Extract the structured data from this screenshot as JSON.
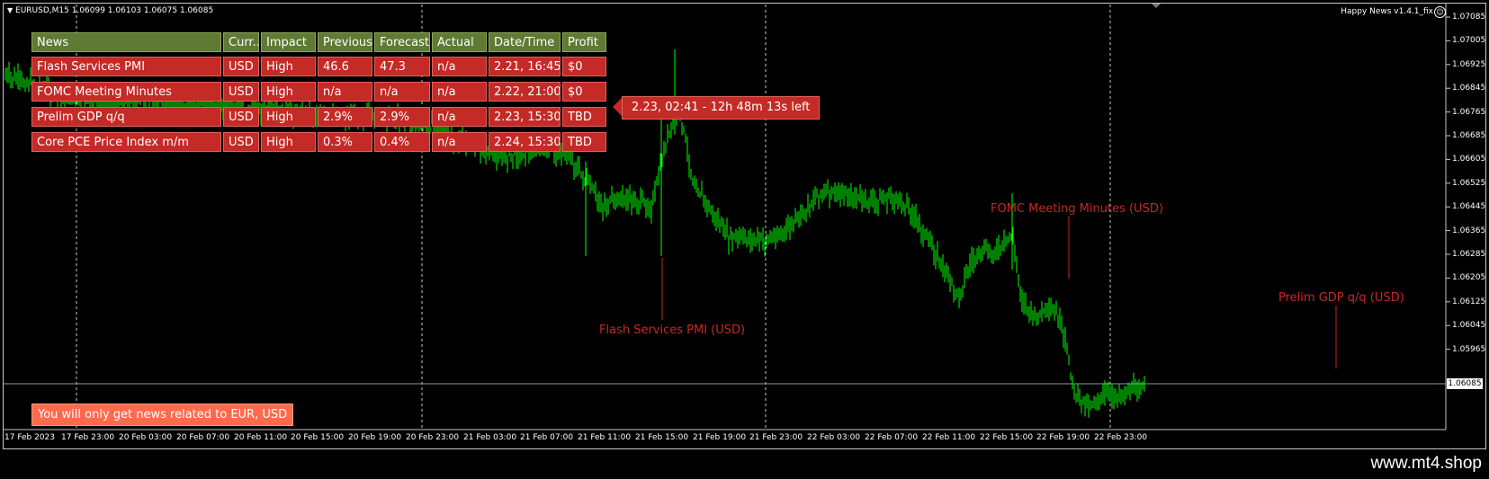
{
  "chart": {
    "symbol_line": "EURUSD,M15  1.06099 1.06103 1.06075 1.06085",
    "indicator_name": "Happy News v1.4.1_fix",
    "smiley_icon": "smiley-icon",
    "current_price": "1.06085",
    "colors": {
      "background": "#000000",
      "candles": "#00ff00",
      "panel_header": "#5e7a33",
      "panel_row": "#c42a26",
      "event_text": "#c42a26",
      "notice": "#ff6a4d"
    },
    "price_axis": [
      {
        "label": "1.07085",
        "price": 1.07085
      },
      {
        "label": "1.07005",
        "price": 1.07005
      },
      {
        "label": "1.06925",
        "price": 1.06925
      },
      {
        "label": "1.06845",
        "price": 1.06845
      },
      {
        "label": "1.06765",
        "price": 1.06765
      },
      {
        "label": "1.06685",
        "price": 1.06685
      },
      {
        "label": "1.06605",
        "price": 1.06605
      },
      {
        "label": "1.06525",
        "price": 1.06525
      },
      {
        "label": "1.06445",
        "price": 1.06445
      },
      {
        "label": "1.06365",
        "price": 1.06365
      },
      {
        "label": "1.06285",
        "price": 1.06285
      },
      {
        "label": "1.06205",
        "price": 1.06205
      },
      {
        "label": "1.06125",
        "price": 1.06125
      },
      {
        "label": "1.06045",
        "price": 1.06045
      },
      {
        "label": "1.05965",
        "price": 1.05965
      }
    ],
    "time_axis": [
      "17 Feb 2023",
      "17 Feb 23:00",
      "20 Feb 03:00",
      "20 Feb 07:00",
      "20 Feb 11:00",
      "20 Feb 15:00",
      "20 Feb 19:00",
      "20 Feb 23:00",
      "21 Feb 03:00",
      "21 Feb 07:00",
      "21 Feb 11:00",
      "21 Feb 15:00",
      "21 Feb 19:00",
      "21 Feb 23:00",
      "22 Feb 03:00",
      "22 Feb 07:00",
      "22 Feb 11:00",
      "22 Feb 15:00",
      "22 Feb 19:00",
      "22 Feb 23:00"
    ]
  },
  "news_table": {
    "headers": [
      "News",
      "Curr..",
      "Impact",
      "Previous",
      "Forecast",
      "Actual",
      "Date/Time",
      "Profit"
    ],
    "rows": [
      [
        "Flash Services PMI",
        "USD",
        "High",
        "46.6",
        "47.3",
        "n/a",
        "2.21, 16:45",
        "$0"
      ],
      [
        "FOMC Meeting Minutes",
        "USD",
        "High",
        "n/a",
        "n/a",
        "n/a",
        "2.22, 21:00",
        "$0"
      ],
      [
        "Prelim GDP q/q",
        "USD",
        "High",
        "2.9%",
        "2.9%",
        "n/a",
        "2.23, 15:30",
        "TBD"
      ],
      [
        "Core PCE Price Index m/m",
        "USD",
        "High",
        "0.3%",
        "0.4%",
        "n/a",
        "2.24, 15:30",
        "TBD"
      ]
    ]
  },
  "countdown": "2.23, 02:41 - 12h 48m 13s left",
  "events": [
    {
      "label": "Flash Services PMI (USD)"
    },
    {
      "label": "FOMC Meeting Minutes (USD)"
    },
    {
      "label": "Prelim GDP q/q (USD)"
    }
  ],
  "notice": "You will only get news related to EUR, USD",
  "watermark": "www.mt4.shop"
}
